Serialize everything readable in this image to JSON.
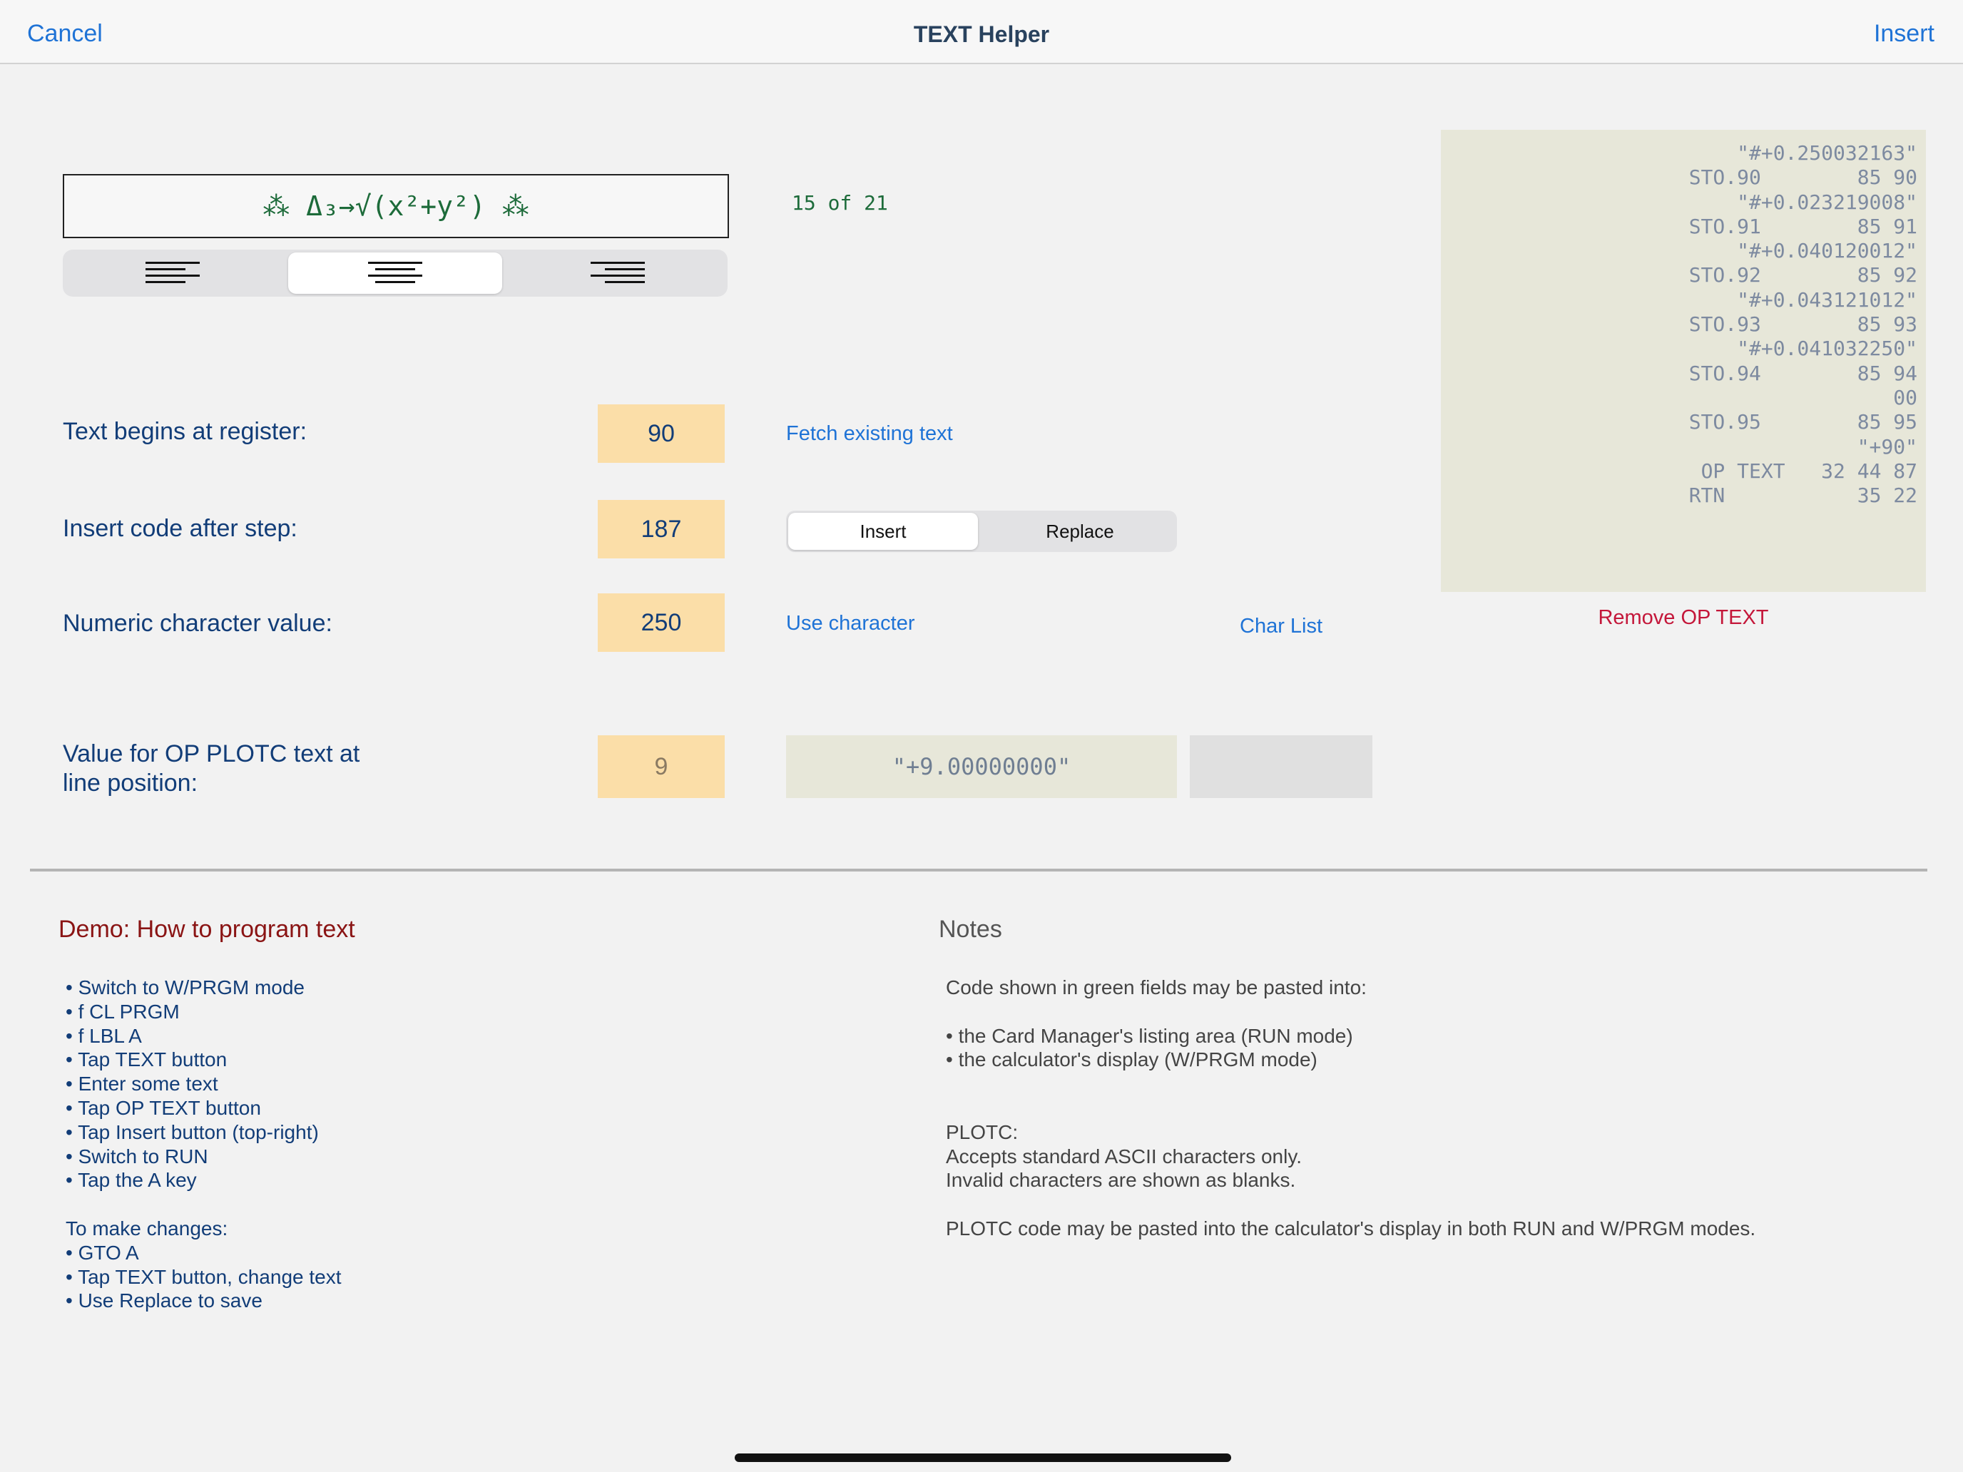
{
  "navbar": {
    "cancel_label": "Cancel",
    "title": "TEXT Helper",
    "insert_label": "Insert"
  },
  "preview": {
    "text": "⁂ Δ₃→√(x²+y²) ⁂",
    "alignment_options": [
      "align-left",
      "align-center",
      "align-right"
    ],
    "selected_alignment": "align-center"
  },
  "counter": "15 of 21",
  "listing": {
    "lines": [
      "\"#+0.250032163\"",
      "STO.90        85 90",
      "\"#+0.023219008\"",
      "STO.91        85 91",
      "\"#+0.040120012\"",
      "STO.92        85 92",
      "\"#+0.043121012\"",
      "STO.93        85 93",
      "\"#+0.041032250\"",
      "STO.94        85 94",
      "00",
      "STO.95        85 95",
      "\"+90\"",
      "OP TEXT   32 44 87",
      "RTN           35 22"
    ],
    "remove_label": "Remove OP TEXT"
  },
  "form": {
    "register_label": "Text begins at register:",
    "register_value": "90",
    "fetch_label": "Fetch existing text",
    "step_label": "Insert code after step:",
    "step_value": "187",
    "mode_options": [
      "Insert",
      "Replace"
    ],
    "mode_selected": "Insert",
    "char_label": "Numeric character value:",
    "char_value": "250",
    "use_char_label": "Use character",
    "char_list_label": "Char List",
    "plotc_label_line1": "Value for OP PLOTC text at",
    "plotc_label_line2": "line position:",
    "plotc_position": "9",
    "plotc_code": "\"+9.00000000\""
  },
  "demo": {
    "title": "Demo: How to program text",
    "lines": [
      "• Switch to W/PRGM mode",
      "• f CL PRGM",
      "• f LBL A",
      "• Tap TEXT button",
      "• Enter some text",
      "• Tap OP TEXT button",
      "• Tap Insert button (top-right)",
      "• Switch to RUN",
      "• Tap the A key",
      "",
      "To make changes:",
      "• GTO A",
      "• Tap TEXT button, change text",
      "• Use Replace to save"
    ]
  },
  "notes": {
    "title": "Notes",
    "lines": [
      "Code shown in green fields may be pasted into:",
      "",
      "• the Card Manager's listing area (RUN mode)",
      "• the calculator's display (W/PRGM mode)",
      "",
      "",
      "PLOTC:",
      "Accepts standard ASCII characters only.",
      "Invalid characters are shown as blanks.",
      "",
      "PLOTC code may be pasted into the calculator's display in both RUN and W/PRGM modes."
    ]
  },
  "colors": {
    "accent": "#1f73d6",
    "label": "#123d78",
    "field": "#fbdea8",
    "listing_bg": "#e7e7d9",
    "remove": "#c4173a",
    "demo_title": "#8a1414",
    "code_green": "#1d6b3a"
  }
}
